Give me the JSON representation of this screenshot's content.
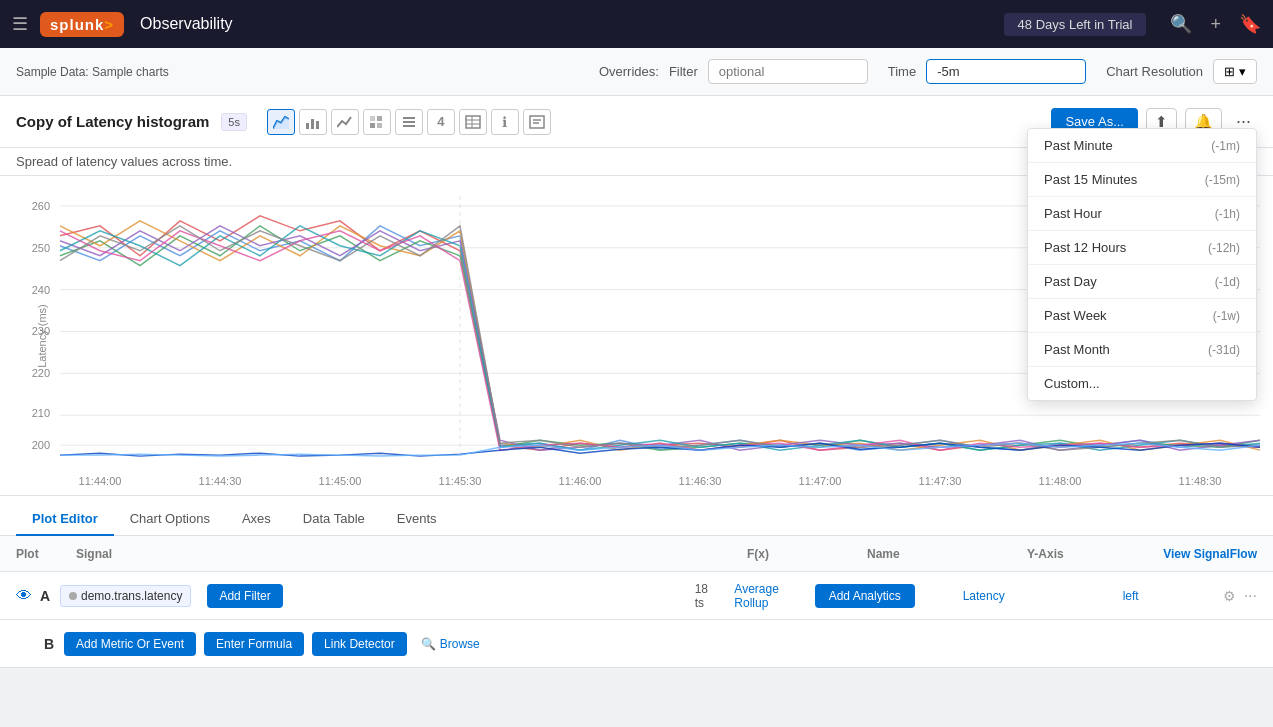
{
  "topnav": {
    "menu_icon": "☰",
    "logo_text": "splunk",
    "logo_arrow": ">",
    "app_title": "Observability",
    "trial_badge": "48 Days Left in Trial",
    "search_icon": "🔍",
    "plus_icon": "+",
    "bookmark_icon": "🔖"
  },
  "overrides_bar": {
    "sample_label": "Sample Data: Sample charts",
    "overrides_label": "Overrides:",
    "filter_label": "Filter",
    "filter_placeholder": "optional",
    "time_label": "Time",
    "time_value": "-5m",
    "chart_resolution_label": "Chart Resolution",
    "resolution_icon": "⊞"
  },
  "chart_header": {
    "title": "Copy of Latency histogram",
    "refresh_badge": "5s",
    "save_button": "Save As...",
    "share_icon": "⬆",
    "bell_icon": "🔔",
    "more_icon": "···"
  },
  "chart_icons": [
    {
      "name": "area-chart",
      "symbol": "📈",
      "active": true
    },
    {
      "name": "bar-chart",
      "symbol": "📊",
      "active": false
    },
    {
      "name": "line-chart",
      "symbol": "〰",
      "active": false
    },
    {
      "name": "heatmap-chart",
      "symbol": "⊞",
      "active": false
    },
    {
      "name": "list-chart",
      "symbol": "≡",
      "active": false
    },
    {
      "name": "number-chart",
      "symbol": "4",
      "active": false
    },
    {
      "name": "table-chart",
      "symbol": "⊟",
      "active": false
    },
    {
      "name": "info-chart",
      "symbol": "ℹ",
      "active": false
    },
    {
      "name": "text-chart",
      "symbol": "T",
      "active": false
    }
  ],
  "chart_desc": "Spread of latency values across time.",
  "time_axis": {
    "labels": [
      "11:44:00",
      "11:44:30",
      "11:45:00",
      "11:45:30",
      "11:46:00",
      "11:46:30",
      "11:47:00",
      "11:47:30",
      "11:48:00",
      "11:48:30"
    ]
  },
  "y_axis": {
    "label": "Latency (ms)",
    "ticks": [
      "200",
      "210",
      "220",
      "230",
      "240",
      "250",
      "260"
    ]
  },
  "time_dropdown": {
    "items": [
      {
        "label": "Past Minute",
        "code": "(-1m)"
      },
      {
        "label": "Past 15 Minutes",
        "code": "(-15m)"
      },
      {
        "label": "Past Hour",
        "code": "(-1h)"
      },
      {
        "label": "Past 12 Hours",
        "code": "(-12h)"
      },
      {
        "label": "Past Day",
        "code": "(-1d)"
      },
      {
        "label": "Past Week",
        "code": "(-1w)"
      },
      {
        "label": "Past Month",
        "code": "(-31d)"
      },
      {
        "label": "Custom...",
        "code": ""
      }
    ]
  },
  "tabs": {
    "items": [
      "Plot Editor",
      "Chart Options",
      "Axes",
      "Data Table",
      "Events"
    ],
    "active": 0
  },
  "plot_editor": {
    "columns": {
      "plot": "Plot",
      "signal": "Signal",
      "fx": "F(x)",
      "name": "Name",
      "yaxis": "Y-Axis",
      "signalflow": "View SignalFlow"
    },
    "row_a": {
      "plot_letter": "A",
      "signal_metric": "demo.trans.latency",
      "add_filter": "Add Filter",
      "ts_count": "18 ts",
      "avg_rollup": "Average Rollup",
      "add_analytics": "Add Analytics",
      "name": "Latency",
      "yaxis": "left"
    },
    "row_b": {
      "plot_letter": "B",
      "add_metric": "Add Metric Or Event",
      "enter_formula": "Enter Formula",
      "link_detector": "Link Detector",
      "browse": "Browse"
    }
  }
}
